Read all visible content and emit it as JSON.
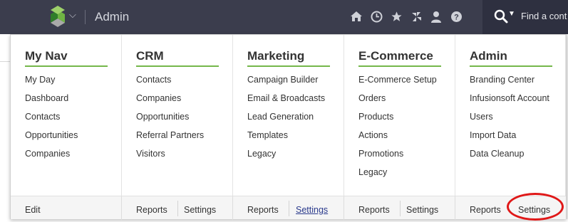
{
  "topbar": {
    "app_title": "Admin",
    "icons": [
      "home-icon",
      "clock-icon",
      "star-icon",
      "pinwheel-icon",
      "person-icon",
      "help-icon"
    ],
    "search_placeholder": "Find a cont"
  },
  "menu": {
    "columns": [
      {
        "title": "My Nav",
        "items": [
          "My Day",
          "Dashboard",
          "Contacts",
          "Opportunities",
          "Companies"
        ]
      },
      {
        "title": "CRM",
        "items": [
          "Contacts",
          "Companies",
          "Opportunities",
          "Referral Partners",
          "Visitors"
        ]
      },
      {
        "title": "Marketing",
        "items": [
          "Campaign Builder",
          "Email & Broadcasts",
          "Lead Generation",
          "Templates",
          "Legacy"
        ]
      },
      {
        "title": "E-Commerce",
        "items": [
          "E-Commerce Setup",
          "Orders",
          "Products",
          "Actions",
          "Promotions",
          "Legacy"
        ]
      },
      {
        "title": "Admin",
        "items": [
          "Branding Center",
          "Infusionsoft Account",
          "Users",
          "Import Data",
          "Data Cleanup"
        ]
      }
    ],
    "footer": {
      "mynav": {
        "edit": "Edit"
      },
      "crm": {
        "reports": "Reports",
        "settings": "Settings"
      },
      "marketing": {
        "reports": "Reports",
        "settings": "Settings"
      },
      "ecommerce": {
        "reports": "Reports",
        "settings": "Settings"
      },
      "admin": {
        "reports": "Reports",
        "settings": "Settings"
      }
    }
  },
  "colors": {
    "topbar": "#3b3d4d",
    "accent_green": "#74b74a",
    "highlight_red": "#e01818"
  }
}
